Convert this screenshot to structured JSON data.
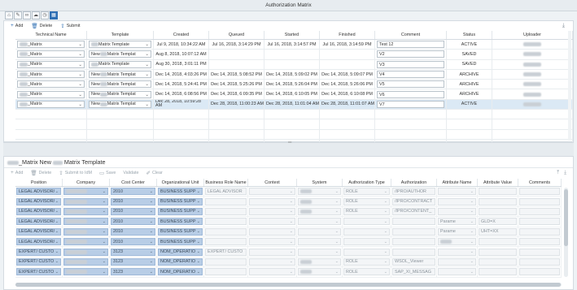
{
  "window": {
    "title": "Authorization Matrix"
  },
  "icons": [
    "home-icon",
    "tools-icon",
    "link-icon",
    "cloud-icon",
    "clock-icon",
    "grid-icon"
  ],
  "top": {
    "toolbar": {
      "add": "Add",
      "delete": "Delete",
      "submit": "Submit"
    },
    "columns": [
      "Technical Name",
      "Template",
      "Created",
      "Queued",
      "Started",
      "Finished",
      "Comment",
      "Status",
      "Uploader"
    ],
    "rows": [
      {
        "tech": "_Matrix",
        "template": "Matrix Template",
        "template_prefix": "",
        "created": "Jul 9, 2018, 10:34:22 AM",
        "queued": "Jul 16, 2018, 3:14:29 PM",
        "started": "Jul 16, 2018, 3:14:57 PM",
        "finished": "Jul 16, 2018, 3:14:59 PM",
        "comment": "Test 12",
        "status": "ACTIVE"
      },
      {
        "tech": "_Matrix",
        "template": "Matrix Templat",
        "template_prefix": "New",
        "created": "Aug 8, 2018, 10:07:12 AM",
        "queued": "",
        "started": "",
        "finished": "",
        "comment": "V2",
        "status": "SAVED"
      },
      {
        "tech": "_Matrix",
        "template": "Matrix Template",
        "template_prefix": "",
        "created": "Aug 30, 2018, 3:01:11 PM",
        "queued": "",
        "started": "",
        "finished": "",
        "comment": "V3",
        "status": "SAVED"
      },
      {
        "tech": "_Matrix",
        "template": "Matrix Templat",
        "template_prefix": "New",
        "created": "Dec 14, 2018, 4:03:26 PM",
        "queued": "Dec 14, 2018, 5:08:52 PM",
        "started": "Dec 14, 2018, 5:09:02 PM",
        "finished": "Dec 14, 2018, 5:09:07 PM",
        "comment": "V4",
        "status": "ARCHIVE"
      },
      {
        "tech": "_Matrix",
        "template": "Matrix Templat",
        "template_prefix": "New",
        "created": "Dec 14, 2018, 5:24:41 PM",
        "queued": "Dec 14, 2018, 5:25:26 PM",
        "started": "Dec 14, 2018, 5:26:04 PM",
        "finished": "Dec 14, 2018, 5:26:06 PM",
        "comment": "V5",
        "status": "ARCHIVE"
      },
      {
        "tech": "_Matrix",
        "template": "Matrix Templat",
        "template_prefix": "New",
        "created": "Dec 14, 2018, 6:08:56 PM",
        "queued": "Dec 14, 2018, 6:09:35 PM",
        "started": "Dec 14, 2018, 6:10:05 PM",
        "finished": "Dec 14, 2018, 6:10:08 PM",
        "comment": "V6",
        "status": "ARCHIVE"
      },
      {
        "tech": "_Matrix",
        "template": "Matrix Templat",
        "template_prefix": "New",
        "created": "Dec 28, 2018, 10:59:28 AM",
        "queued": "Dec 28, 2018, 11:00:23 AM",
        "started": "Dec 28, 2018, 11:01:04 AM",
        "finished": "Dec 28, 2018, 11:01:07 AM",
        "comment": "V7",
        "status": "ACTIVE"
      }
    ]
  },
  "bottom": {
    "title": "_Matrix New Matrix Template",
    "toolbar": {
      "add": "Add",
      "delete": "Delete",
      "submit_idm": "Submit to IdM",
      "save": "Save",
      "validate": "Validate",
      "clear": "Clear"
    },
    "columns": [
      "Position",
      "Company",
      "Cost Center",
      "Organizational Unit",
      "Business Role Name",
      "Context",
      "System",
      "Authorization Type",
      "Authorization",
      "Attribute Name",
      "Attribute Value",
      "Comments"
    ],
    "rows": [
      {
        "position": "LEGAL ADVISOR/",
        "cost": "2010",
        "org": "BUSINESS SUPP",
        "brole": "LEGAL ADVISOR",
        "authtype": "ROLE",
        "auth": "/IPRO/AUTHOR",
        "attrname": "",
        "attrval": ""
      },
      {
        "position": "LEGAL ADVISOR/",
        "cost": "2010",
        "org": "BUSINESS SUPP",
        "brole": "",
        "authtype": "ROLE",
        "auth": "/IPRO/CONTRACT",
        "attrname": "",
        "attrval": ""
      },
      {
        "position": "LEGAL ADVISOR/",
        "cost": "2010",
        "org": "BUSINESS SUPP",
        "brole": "",
        "authtype": "ROLE",
        "auth": "/IPRO/CONTENT_",
        "attrname": "",
        "attrval": ""
      },
      {
        "position": "LEGAL ADVISOR/",
        "cost": "2010",
        "org": "BUSINESS SUPP",
        "brole": "",
        "authtype": "",
        "auth": "",
        "attrname": "Parame",
        "attrval": "GLD=X"
      },
      {
        "position": "LEGAL ADVISOR/",
        "cost": "2010",
        "org": "BUSINESS SUPP",
        "brole": "",
        "authtype": "",
        "auth": "",
        "attrname": "Parame",
        "attrval": "UHT=XX"
      },
      {
        "position": "LEGAL ADVISOR/",
        "cost": "2010",
        "org": "BUSINESS SUPP",
        "brole": "",
        "authtype": "",
        "auth": "",
        "attrname": "",
        "attrval": ""
      },
      {
        "position": "EXPERT/ CUSTO",
        "cost": "3123",
        "org": "NOM_OPERATIO",
        "brole": "EXPERT/ CUSTO",
        "authtype": "",
        "auth": "",
        "attrname": "",
        "attrval": ""
      },
      {
        "position": "EXPERT/ CUSTO",
        "cost": "3123",
        "org": "NOM_OPERATIO",
        "brole": "",
        "authtype": "ROLE",
        "auth": "WSOL_Viewer",
        "attrname": "",
        "attrval": ""
      },
      {
        "position": "EXPERT/ CUSTO",
        "cost": "3123",
        "org": "NOM_OPERATIO",
        "brole": "",
        "authtype": "ROLE",
        "auth": "SAP_XI_MESSAG",
        "attrname": "",
        "attrval": ""
      }
    ]
  }
}
